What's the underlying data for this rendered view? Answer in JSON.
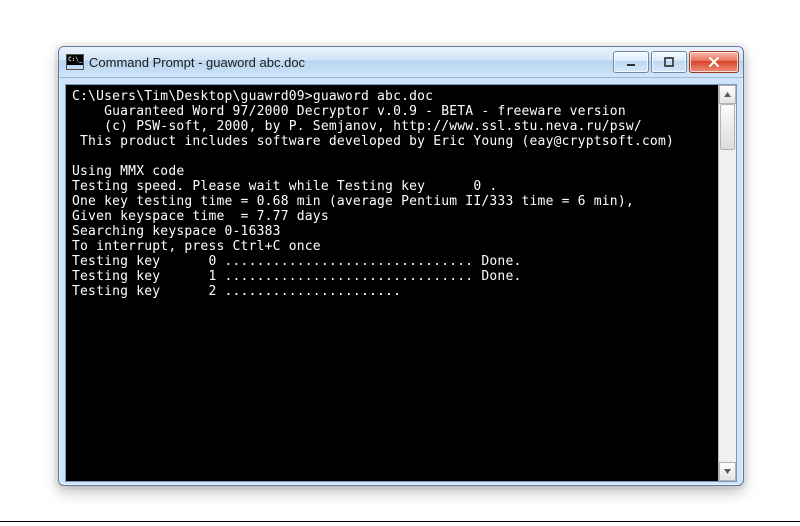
{
  "window": {
    "title": "Command Prompt - guaword  abc.doc"
  },
  "terminal": {
    "prompt_path": "C:\\Users\\Tim\\Desktop\\guawrd09>",
    "command": "guaword abc.doc",
    "banner_line1": "    Guaranteed Word 97/2000 Decryptor v.0.9 - BETA - freeware version",
    "banner_line2": "    (c) PSW-soft, 2000, by P. Semjanov, http://www.ssl.stu.neva.ru/psw/",
    "banner_line3": " This product includes software developed by Eric Young (eay@cryptsoft.com)",
    "blank": "",
    "using_mmx": "Using MMX code",
    "testing_speed": "Testing speed. Please wait while Testing key      0 .",
    "one_key_time": "One key testing time = 0.68 min (average Pentium II/333 time = 6 min),",
    "given_keyspace": "Given keyspace time  = 7.77 days",
    "searching": "Searching keyspace 0-16383",
    "interrupt_hint": "To interrupt, press Ctrl+C once",
    "progress": [
      "Testing key      0 ............................... Done.",
      "Testing key      1 ............................... Done.",
      "Testing key      2 ......................"
    ]
  }
}
